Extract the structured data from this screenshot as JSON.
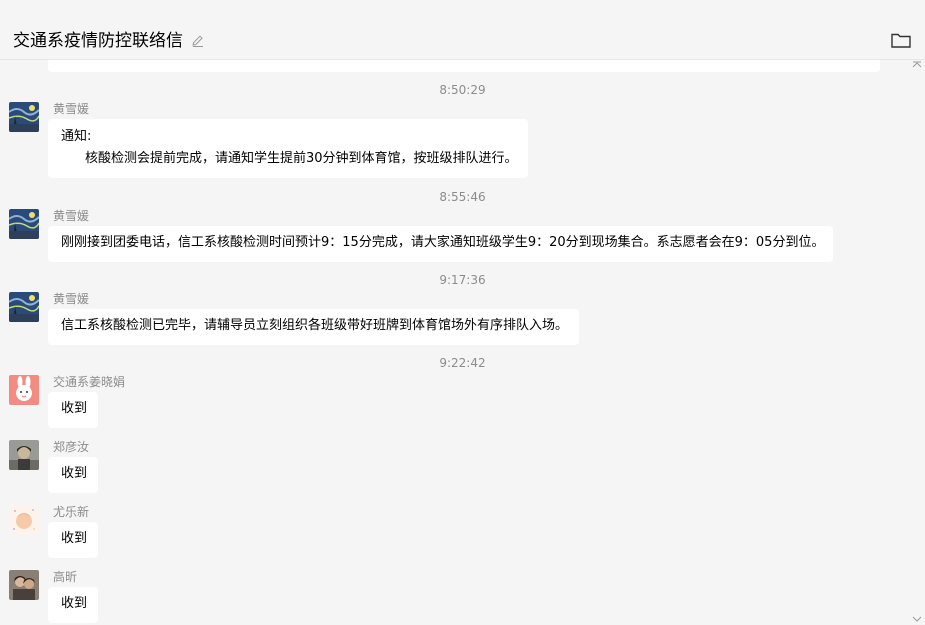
{
  "header": {
    "title": "交通系疫情防控联络信"
  },
  "icons": {
    "edit": "pencil-icon",
    "folder": "folder-icon",
    "scroll_up": "chevron-up-icon",
    "scroll_down": "chevron-down-icon"
  },
  "colors": {
    "background": "#f5f5f5",
    "bubble": "#ffffff",
    "meta_text": "#8c8c8c"
  },
  "messages": [
    {
      "time": "8:50:29",
      "sender": "黄雪媛",
      "lines": [
        "通知:",
        "核酸检测会提前完成，请通知学生提前30分钟到体育馆，按班级排队进行。"
      ]
    },
    {
      "time": "8:55:46",
      "sender": "黄雪媛",
      "lines": [
        "刚刚接到团委电话，信工系核酸检测时间预计9：15分完成，请大家通知班级学生9：20分到现场集合。系志愿者会在9：05分到位。"
      ]
    },
    {
      "time": "9:17:36",
      "sender": "黄雪媛",
      "lines": [
        "信工系核酸检测已完毕，请辅导员立刻组织各班级带好班牌到体育馆场外有序排队入场。"
      ]
    },
    {
      "time": "9:22:42",
      "sender": "交通系姜晓娟",
      "lines": [
        "收到"
      ]
    },
    {
      "sender": "郑彦汝",
      "lines": [
        "收到"
      ]
    },
    {
      "sender": "尤乐新",
      "lines": [
        "收到"
      ]
    },
    {
      "sender": "高昕",
      "lines": [
        "收到"
      ]
    }
  ]
}
